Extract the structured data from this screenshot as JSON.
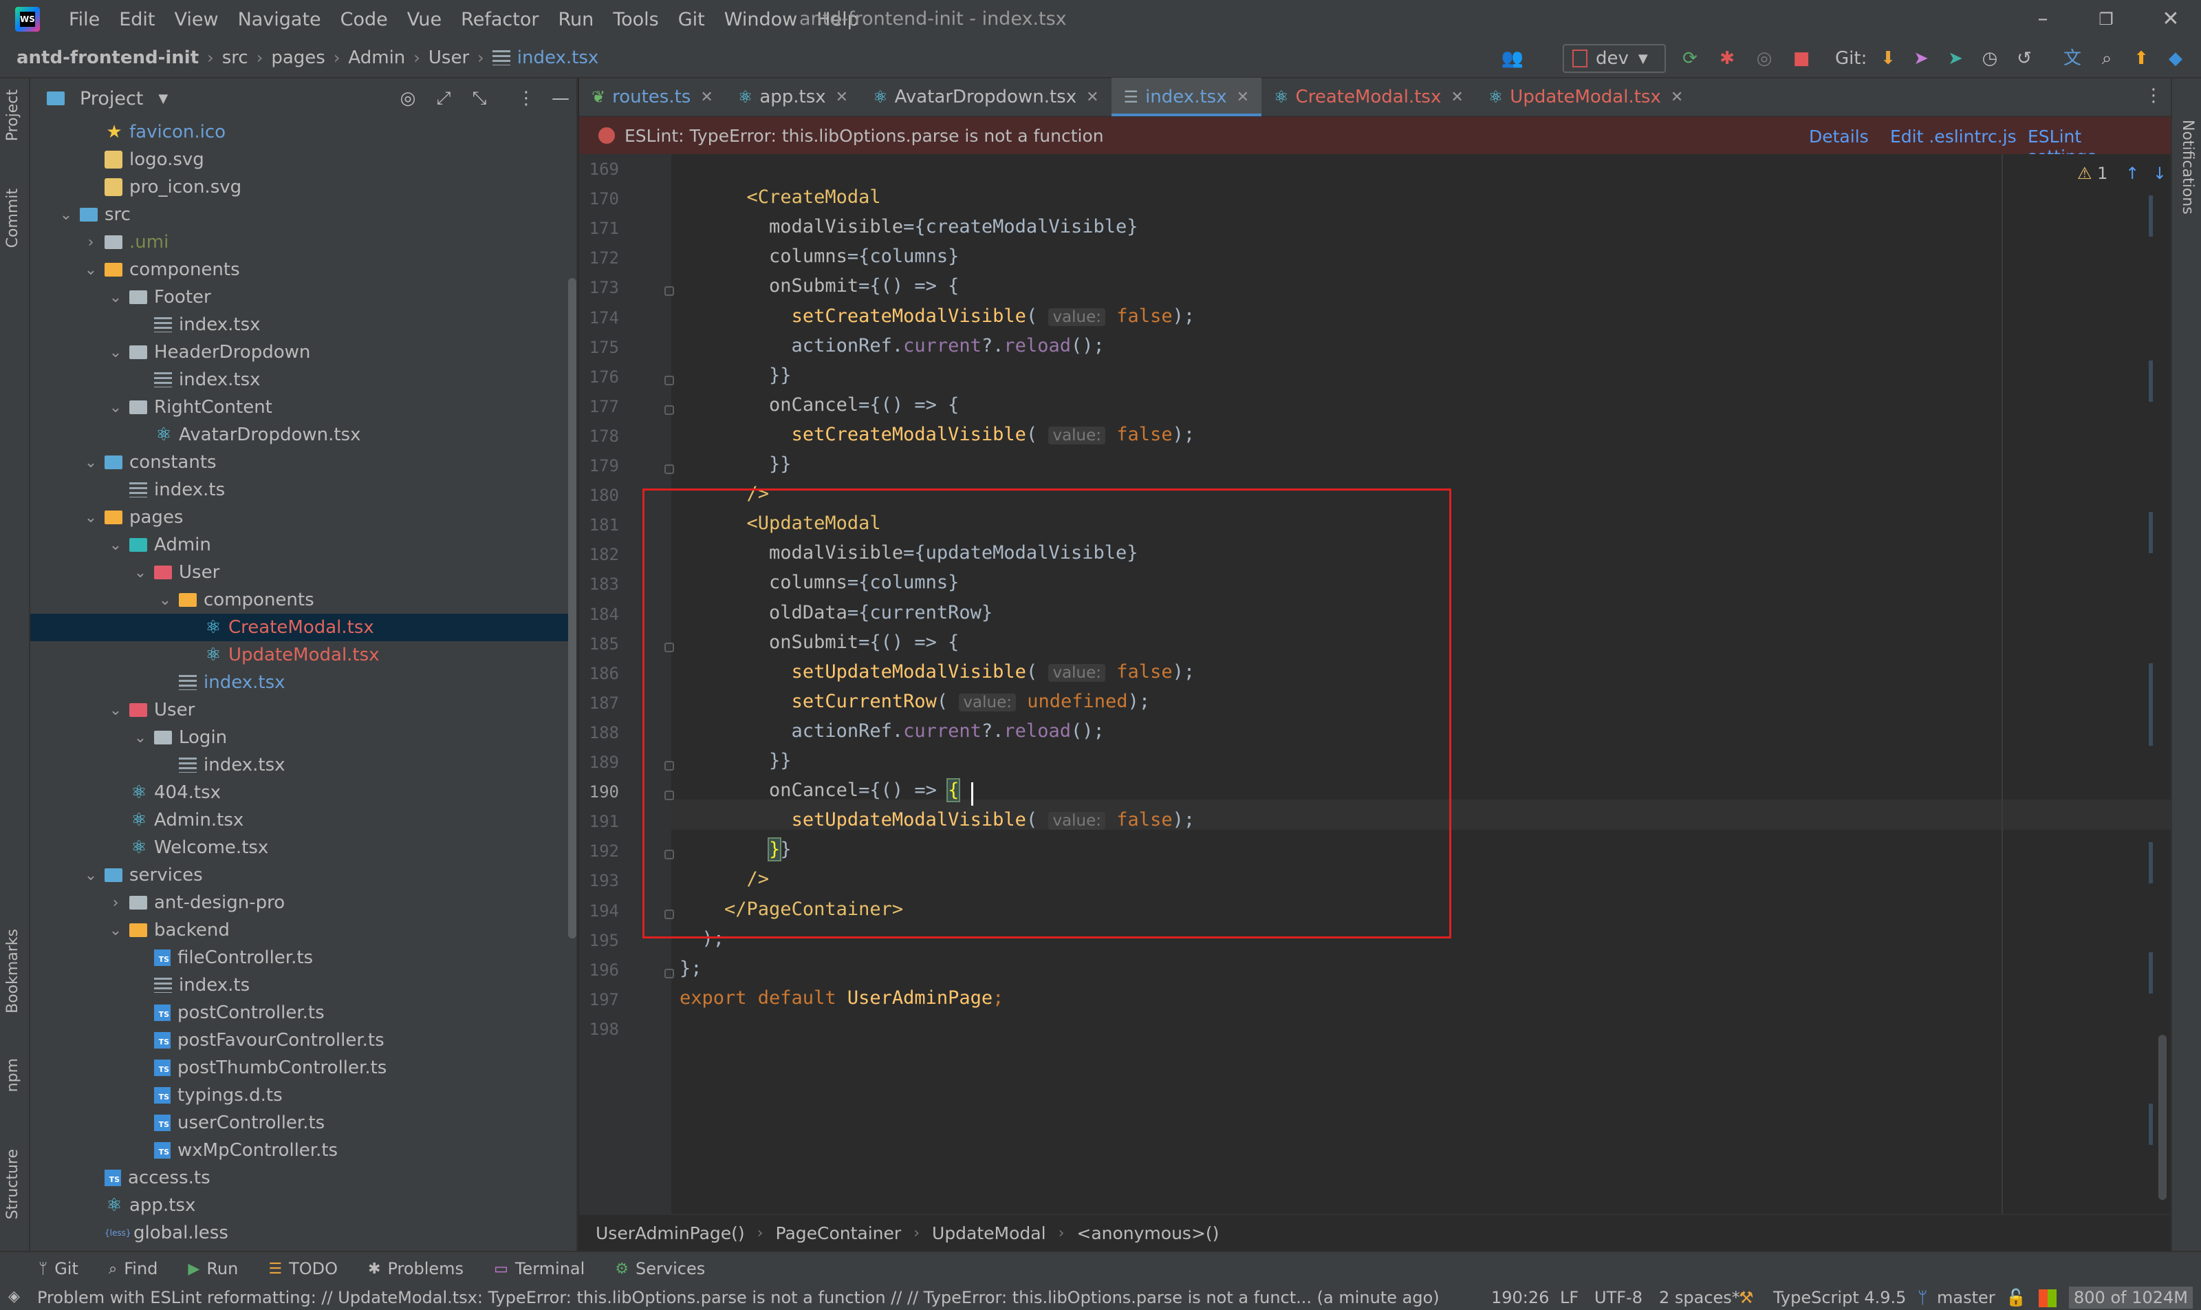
{
  "menubar": {
    "items": [
      "File",
      "Edit",
      "View",
      "Navigate",
      "Code",
      "Vue",
      "Refactor",
      "Run",
      "Tools",
      "Git",
      "Window",
      "Help"
    ],
    "window_title": "antd-frontend-init - index.tsx"
  },
  "navbar": {
    "crumbs": [
      "antd-frontend-init",
      "src",
      "pages",
      "Admin",
      "User",
      "index.tsx"
    ],
    "branch": "dev",
    "git_label": "Git:"
  },
  "left_strip": {
    "tabs": [
      "Project",
      "Commit",
      "Bookmarks",
      "npm",
      "Structure"
    ]
  },
  "right_strip": {
    "tabs": [
      "Notifications"
    ]
  },
  "project_panel": {
    "title": "Project",
    "tree": [
      {
        "indent": 1,
        "arrow": "",
        "icon": "star",
        "label": "favicon.ico",
        "color": "blue"
      },
      {
        "indent": 1,
        "arrow": "",
        "icon": "svg",
        "label": "logo.svg",
        "color": ""
      },
      {
        "indent": 1,
        "arrow": "",
        "icon": "svg",
        "label": "pro_icon.svg",
        "color": ""
      },
      {
        "indent": 0,
        "arrow": "v",
        "icon": "folder-blue",
        "label": "src",
        "color": ""
      },
      {
        "indent": 1,
        "arrow": ">",
        "icon": "folder",
        "label": ".umi",
        "color": "olive"
      },
      {
        "indent": 1,
        "arrow": "v",
        "icon": "folder-orange",
        "label": "components",
        "color": ""
      },
      {
        "indent": 2,
        "arrow": "v",
        "icon": "folder",
        "label": "Footer",
        "color": ""
      },
      {
        "indent": 3,
        "arrow": "",
        "icon": "lines",
        "label": "index.tsx",
        "color": ""
      },
      {
        "indent": 2,
        "arrow": "v",
        "icon": "folder",
        "label": "HeaderDropdown",
        "color": ""
      },
      {
        "indent": 3,
        "arrow": "",
        "icon": "lines",
        "label": "index.tsx",
        "color": ""
      },
      {
        "indent": 2,
        "arrow": "v",
        "icon": "folder",
        "label": "RightContent",
        "color": ""
      },
      {
        "indent": 3,
        "arrow": "",
        "icon": "react",
        "label": "AvatarDropdown.tsx",
        "color": ""
      },
      {
        "indent": 1,
        "arrow": "v",
        "icon": "folder-blue",
        "label": "constants",
        "color": ""
      },
      {
        "indent": 2,
        "arrow": "",
        "icon": "lines",
        "label": "index.ts",
        "color": ""
      },
      {
        "indent": 1,
        "arrow": "v",
        "icon": "folder-orange",
        "label": "pages",
        "color": ""
      },
      {
        "indent": 2,
        "arrow": "v",
        "icon": "folder-teal",
        "label": "Admin",
        "color": ""
      },
      {
        "indent": 3,
        "arrow": "v",
        "icon": "folder-red",
        "label": "User",
        "color": ""
      },
      {
        "indent": 4,
        "arrow": "v",
        "icon": "folder-orange",
        "label": "components",
        "color": ""
      },
      {
        "indent": 5,
        "arrow": "",
        "icon": "react",
        "label": "CreateModal.tsx",
        "color": "red",
        "selected": true
      },
      {
        "indent": 5,
        "arrow": "",
        "icon": "react",
        "label": "UpdateModal.tsx",
        "color": "red"
      },
      {
        "indent": 4,
        "arrow": "",
        "icon": "lines",
        "label": "index.tsx",
        "color": "blue"
      },
      {
        "indent": 2,
        "arrow": "v",
        "icon": "folder-red",
        "label": "User",
        "color": ""
      },
      {
        "indent": 3,
        "arrow": "v",
        "icon": "folder",
        "label": "Login",
        "color": ""
      },
      {
        "indent": 4,
        "arrow": "",
        "icon": "lines",
        "label": "index.tsx",
        "color": ""
      },
      {
        "indent": 2,
        "arrow": "",
        "icon": "react",
        "label": "404.tsx",
        "color": ""
      },
      {
        "indent": 2,
        "arrow": "",
        "icon": "react",
        "label": "Admin.tsx",
        "color": ""
      },
      {
        "indent": 2,
        "arrow": "",
        "icon": "react",
        "label": "Welcome.tsx",
        "color": ""
      },
      {
        "indent": 1,
        "arrow": "v",
        "icon": "folder-blue",
        "label": "services",
        "color": ""
      },
      {
        "indent": 2,
        "arrow": ">",
        "icon": "folder",
        "label": "ant-design-pro",
        "color": ""
      },
      {
        "indent": 2,
        "arrow": "v",
        "icon": "folder-orange",
        "label": "backend",
        "color": ""
      },
      {
        "indent": 3,
        "arrow": "",
        "icon": "ts",
        "label": "fileController.ts",
        "color": ""
      },
      {
        "indent": 3,
        "arrow": "",
        "icon": "lines",
        "label": "index.ts",
        "color": ""
      },
      {
        "indent": 3,
        "arrow": "",
        "icon": "ts",
        "label": "postController.ts",
        "color": ""
      },
      {
        "indent": 3,
        "arrow": "",
        "icon": "ts",
        "label": "postFavourController.ts",
        "color": ""
      },
      {
        "indent": 3,
        "arrow": "",
        "icon": "ts",
        "label": "postThumbController.ts",
        "color": ""
      },
      {
        "indent": 3,
        "arrow": "",
        "icon": "ts",
        "label": "typings.d.ts",
        "color": ""
      },
      {
        "indent": 3,
        "arrow": "",
        "icon": "ts",
        "label": "userController.ts",
        "color": ""
      },
      {
        "indent": 3,
        "arrow": "",
        "icon": "ts",
        "label": "wxMpController.ts",
        "color": ""
      },
      {
        "indent": 1,
        "arrow": "",
        "icon": "ts",
        "label": "access.ts",
        "color": ""
      },
      {
        "indent": 1,
        "arrow": "",
        "icon": "react",
        "label": "app.tsx",
        "color": ""
      },
      {
        "indent": 1,
        "arrow": "",
        "icon": "less",
        "label": "global.less",
        "color": ""
      }
    ]
  },
  "editor_tabs": [
    {
      "label": "routes.ts",
      "icon": "ts-leaf",
      "active": false,
      "color": "blue"
    },
    {
      "label": "app.tsx",
      "icon": "react",
      "active": false,
      "color": ""
    },
    {
      "label": "AvatarDropdown.tsx",
      "icon": "react",
      "active": false,
      "color": ""
    },
    {
      "label": "index.tsx",
      "icon": "lines",
      "active": true,
      "color": "blue"
    },
    {
      "label": "CreateModal.tsx",
      "icon": "react",
      "active": false,
      "color": "red"
    },
    {
      "label": "UpdateModal.tsx",
      "icon": "react",
      "active": false,
      "color": "red"
    }
  ],
  "eslint_banner": {
    "message": "ESLint: TypeError: this.libOptions.parse is not a function",
    "links": [
      "Details",
      "Edit .eslintrc.js",
      "ESLint settings..."
    ]
  },
  "editor": {
    "warning_count": "1",
    "lines": [
      {
        "no": "169",
        "html": ""
      },
      {
        "no": "170",
        "html": "      <span class='tag'>&lt;CreateModal</span>"
      },
      {
        "no": "171",
        "html": "        <span class='attr'>modalVisible</span>={createModalVisible}"
      },
      {
        "no": "172",
        "html": "        <span class='attr'>columns</span>={columns}"
      },
      {
        "no": "173",
        "html": "        <span class='attr'>onSubmit</span>={() =&gt; {"
      },
      {
        "no": "174",
        "html": "          <span class='fn'>setCreateModalVisible</span>( <span class='hint'>value:</span> <span class='kw'>false</span>);"
      },
      {
        "no": "175",
        "html": "          actionRef.<span class='prop'>current</span>?.<span class='prop'>reload</span>();"
      },
      {
        "no": "176",
        "html": "        }}"
      },
      {
        "no": "177",
        "html": "        <span class='attr'>onCancel</span>={() =&gt; {"
      },
      {
        "no": "178",
        "html": "          <span class='fn'>setCreateModalVisible</span>( <span class='hint'>value:</span> <span class='kw'>false</span>);"
      },
      {
        "no": "179",
        "html": "        }}"
      },
      {
        "no": "180",
        "html": "      <span class='tag'>/&gt;</span>"
      },
      {
        "no": "181",
        "html": "      <span class='tag'>&lt;UpdateModal</span>"
      },
      {
        "no": "182",
        "html": "        <span class='attr'>modalVisible</span>={updateModalVisible}"
      },
      {
        "no": "183",
        "html": "        <span class='attr'>columns</span>={columns}"
      },
      {
        "no": "184",
        "html": "        <span class='attr'>oldData</span>={currentRow}"
      },
      {
        "no": "185",
        "html": "        <span class='attr'>onSubmit</span>={() =&gt; {"
      },
      {
        "no": "186",
        "html": "          <span class='fn'>setUpdateModalVisible</span>( <span class='hint'>value:</span> <span class='kw'>false</span>);"
      },
      {
        "no": "187",
        "html": "          <span class='fn'>setCurrentRow</span>( <span class='hint'>value:</span> <span class='kw'>undefined</span>);"
      },
      {
        "no": "188",
        "html": "          actionRef.<span class='prop'>current</span>?.<span class='prop'>reload</span>();"
      },
      {
        "no": "189",
        "html": "        }}"
      },
      {
        "no": "190",
        "html": "        <span class='attr'>onCancel</span>={() =&gt; <span class='brace-match'>{</span>"
      },
      {
        "no": "191",
        "html": "          <span class='fn'>setUpdateModalVisible</span>( <span class='hint'>value:</span> <span class='kw'>false</span>);"
      },
      {
        "no": "192",
        "html": "        <span class='brace-match'>}</span>}"
      },
      {
        "no": "193",
        "html": "      <span class='tag'>/&gt;</span>"
      },
      {
        "no": "194",
        "html": "    <span class='tag'>&lt;/PageContainer&gt;</span>"
      },
      {
        "no": "195",
        "html": "  );"
      },
      {
        "no": "196",
        "html": "};"
      },
      {
        "no": "197",
        "html": "<span class='kw'>export default</span> <span class='fn'>UserAdminPage</span><span class='kw'>;</span>"
      },
      {
        "no": "198",
        "html": ""
      }
    ]
  },
  "code_breadcrumbs": [
    "UserAdminPage()",
    "PageContainer",
    "UpdateModal",
    "<anonymous>()"
  ],
  "bottom_tools": [
    {
      "label": "Git",
      "icon": "git-icon"
    },
    {
      "label": "Find",
      "icon": "search-icon"
    },
    {
      "label": "Run",
      "icon": "play-icon"
    },
    {
      "label": "TODO",
      "icon": "list-icon"
    },
    {
      "label": "Problems",
      "icon": "warning-icon"
    },
    {
      "label": "Terminal",
      "icon": "terminal-icon"
    },
    {
      "label": "Services",
      "icon": "gear-icon"
    }
  ],
  "statusbar": {
    "message": "Problem with ESLint reformatting: // UpdateModal.tsx: TypeError: this.libOptions.parse is not a function // // TypeError: this.libOptions.parse is not a funct... (a minute ago)",
    "position": "190:26",
    "line_sep": "LF",
    "encoding": "UTF-8",
    "indent": "2 spaces*",
    "language": "TypeScript 4.9.5",
    "branch": "master",
    "memory": "800 of 1024M"
  },
  "colors": {
    "accent": "#4a88c7",
    "error_banner": "#4d2a2a",
    "highlight_rect": "#e02020"
  }
}
